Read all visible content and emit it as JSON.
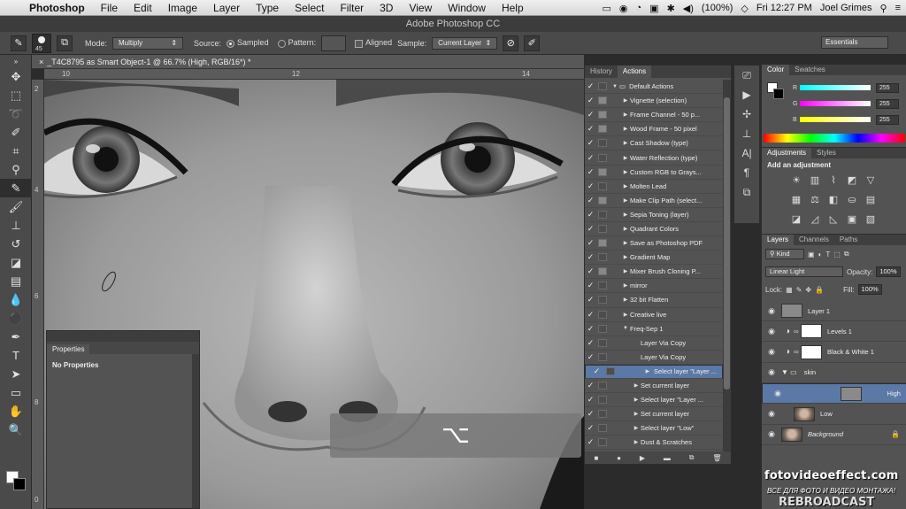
{
  "menubar": {
    "app": "Photoshop",
    "items": [
      "File",
      "Edit",
      "Image",
      "Layer",
      "Type",
      "Select",
      "Filter",
      "3D",
      "View",
      "Window",
      "Help"
    ],
    "battery": "(100%)",
    "clock": "Fri 12:27 PM",
    "user": "Joel Grimes"
  },
  "window_title": "Adobe Photoshop CC",
  "options": {
    "brush_size": "45",
    "mode_label": "Mode:",
    "mode_value": "Multiply",
    "source_label": "Source:",
    "sampled_label": "Sampled",
    "pattern_label": "Pattern:",
    "aligned_label": "Aligned",
    "sample_label": "Sample:",
    "sample_value": "Current Layer",
    "workspace": "Essentials"
  },
  "document": {
    "tab_title": "_T4C8795 as Smart Object-1 @ 66.7% (High, RGB/16*) *",
    "ruler_h": [
      "10",
      "12",
      "14"
    ],
    "ruler_v": [
      "2",
      "4",
      "6",
      "8",
      "0"
    ]
  },
  "properties": {
    "tab": "Properties",
    "empty_text": "No Properties"
  },
  "shortcut_overlay": "⌥",
  "actions_panel": {
    "tabs": [
      "History",
      "Actions"
    ],
    "active_tab": "Actions",
    "items": [
      {
        "label": "Default Actions",
        "level": 0,
        "folder": true,
        "dlg": false
      },
      {
        "label": "Vignette (selection)",
        "level": 1,
        "dlg": true
      },
      {
        "label": "Frame Channel - 50 p...",
        "level": 1,
        "dlg": true
      },
      {
        "label": "Wood Frame - 50 pixel",
        "level": 1,
        "dlg": true
      },
      {
        "label": "Cast Shadow (type)",
        "level": 1,
        "dlg": false
      },
      {
        "label": "Water Reflection (type)",
        "level": 1,
        "dlg": false
      },
      {
        "label": "Custom RGB to Grays...",
        "level": 1,
        "dlg": true
      },
      {
        "label": "Molten Lead",
        "level": 1,
        "dlg": false
      },
      {
        "label": "Make Clip Path (select...",
        "level": 1,
        "dlg": true
      },
      {
        "label": "Sepia Toning (layer)",
        "level": 1,
        "dlg": false
      },
      {
        "label": "Quadrant Colors",
        "level": 1,
        "dlg": false
      },
      {
        "label": "Save as Photoshop PDF",
        "level": 1,
        "dlg": true
      },
      {
        "label": "Gradient Map",
        "level": 1,
        "dlg": false
      },
      {
        "label": "Mixer Brush Cloning P...",
        "level": 1,
        "dlg": true
      },
      {
        "label": "mirror",
        "level": 1,
        "dlg": false
      },
      {
        "label": "32 bit Flatten",
        "level": 1,
        "dlg": false
      },
      {
        "label": "Creative live",
        "level": 1,
        "dlg": false
      },
      {
        "label": "Freq-Sep 1",
        "level": 1,
        "open": true,
        "dlg": false
      },
      {
        "label": "Layer Via Copy",
        "level": 2,
        "dlg": false
      },
      {
        "label": "Layer Via Copy",
        "level": 2,
        "dlg": false
      },
      {
        "label": "Select layer \"Layer ...",
        "level": 2,
        "dlg": false,
        "selected": true
      },
      {
        "label": "Set current layer",
        "level": 2,
        "dlg": false
      },
      {
        "label": "Select layer \"Layer ...",
        "level": 2,
        "dlg": false
      },
      {
        "label": "Set current layer",
        "level": 2,
        "dlg": false
      },
      {
        "label": "Select layer \"Low\"",
        "level": 2,
        "dlg": false
      },
      {
        "label": "Dust & Scratches",
        "level": 2,
        "dlg": false
      }
    ]
  },
  "color_panel": {
    "tabs": [
      "Color",
      "Swatches"
    ],
    "channels": [
      {
        "label": "R",
        "value": "255"
      },
      {
        "label": "G",
        "value": "255"
      },
      {
        "label": "B",
        "value": "255"
      }
    ]
  },
  "adjustments_panel": {
    "tabs": [
      "Adjustments",
      "Styles"
    ],
    "title": "Add an adjustment"
  },
  "layers_panel": {
    "tabs": [
      "Layers",
      "Channels",
      "Paths"
    ],
    "filter": "Kind",
    "blend_mode": "Linear Light",
    "opacity_label": "Opacity:",
    "opacity": "100%",
    "lock_label": "Lock:",
    "fill_label": "Fill:",
    "fill": "100%",
    "layers": [
      {
        "name": "Layer 1",
        "thumb": "gray",
        "adjust": false,
        "indent": false
      },
      {
        "name": "Levels 1",
        "thumb": "white",
        "adjust": true,
        "indent": false
      },
      {
        "name": "Black & White 1",
        "thumb": "white",
        "adjust": true,
        "indent": false
      },
      {
        "name": "skin",
        "thumb": "folder",
        "adjust": false,
        "indent": false
      },
      {
        "name": "High",
        "thumb": "gray",
        "adjust": false,
        "indent": true,
        "selected": true
      },
      {
        "name": "Low",
        "thumb": "face",
        "adjust": false,
        "indent": true
      },
      {
        "name": "Background",
        "thumb": "face",
        "adjust": false,
        "indent": false,
        "italic": true,
        "locked": true
      }
    ]
  },
  "watermark": {
    "site": "fotovideoeffect.com",
    "tagline": "ВСЕ ДЛЯ ФОТО И ВИДЕО МОНТАЖА!",
    "brand": "REBROADCAST"
  }
}
